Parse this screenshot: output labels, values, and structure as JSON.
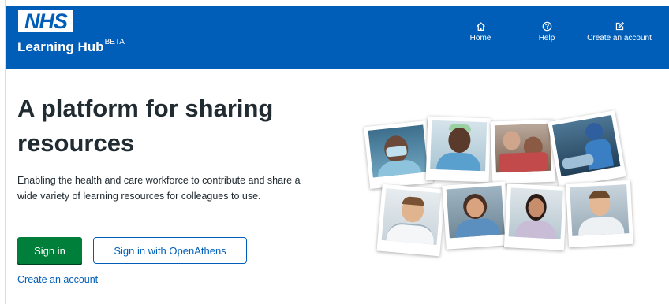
{
  "header": {
    "logo_text": "NHS",
    "brand": "Learning Hub",
    "brand_badge": "BETA",
    "nav": [
      {
        "label": "Home",
        "icon": "home-icon"
      },
      {
        "label": "Help",
        "icon": "help-icon"
      },
      {
        "label": "Create an account",
        "icon": "edit-icon"
      }
    ]
  },
  "hero": {
    "title": "A platform for sharing resources",
    "description": "Enabling the health and care workforce to contribute and share a wide variety of learning resources for colleagues to use.",
    "sign_in_label": "Sign in",
    "openathens_label": "Sign in with OpenAthens",
    "create_account_link": "Create an account"
  },
  "colors": {
    "nhs_blue": "#005eb8",
    "button_green": "#007f3b",
    "text_dark": "#212b32"
  }
}
